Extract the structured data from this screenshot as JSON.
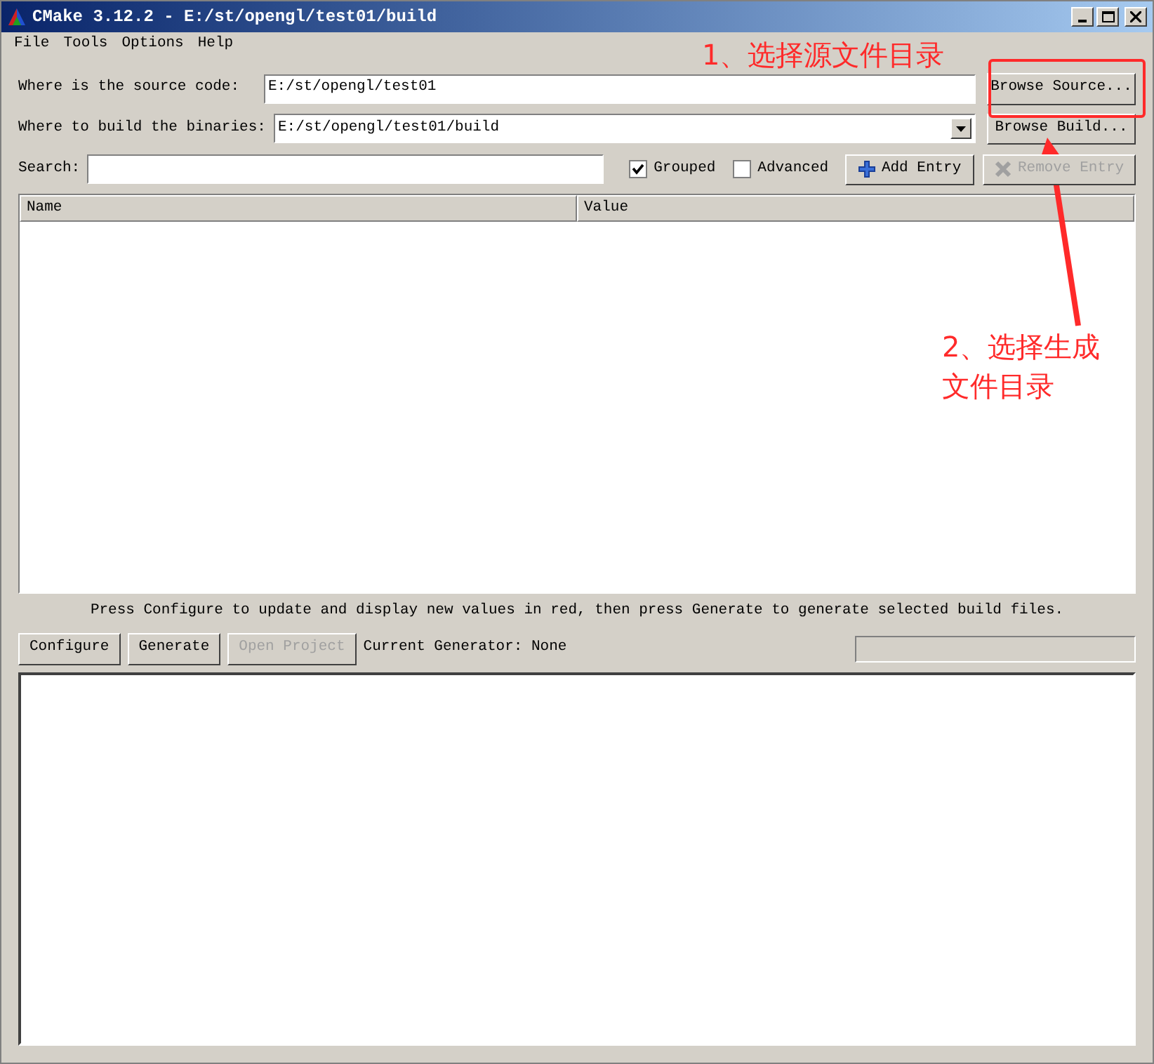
{
  "window": {
    "title": "CMake 3.12.2 - E:/st/opengl/test01/build"
  },
  "menu": [
    "File",
    "Tools",
    "Options",
    "Help"
  ],
  "source": {
    "label": "Where is the source code:",
    "value": "E:/st/opengl/test01",
    "button": "Browse Source..."
  },
  "build": {
    "label": "Where to build the binaries:",
    "value": "E:/st/opengl/test01/build",
    "button": "Browse Build..."
  },
  "search": {
    "label": "Search:"
  },
  "options": [
    {
      "label": "Grouped",
      "checked": true
    },
    {
      "label": "Advanced",
      "checked": false
    }
  ],
  "entry_buttons": [
    {
      "label": "Add Entry",
      "disabled": false,
      "kind": "add"
    },
    {
      "label": "Remove Entry",
      "disabled": true,
      "kind": "remove"
    }
  ],
  "table": {
    "columns": [
      "Name",
      "Value"
    ]
  },
  "message": "Press Configure to update and display new values in red, then press Generate to generate selected build files.",
  "actions": [
    {
      "label": "Configure",
      "disabled": false
    },
    {
      "label": "Generate",
      "disabled": false
    },
    {
      "label": "Open Project",
      "disabled": true
    }
  ],
  "generator": "Current Generator: None",
  "annotations": [
    {
      "text": "1、选择源文件目录"
    },
    {
      "text": "2、选择生成"
    },
    {
      "text": "文件目录"
    }
  ]
}
